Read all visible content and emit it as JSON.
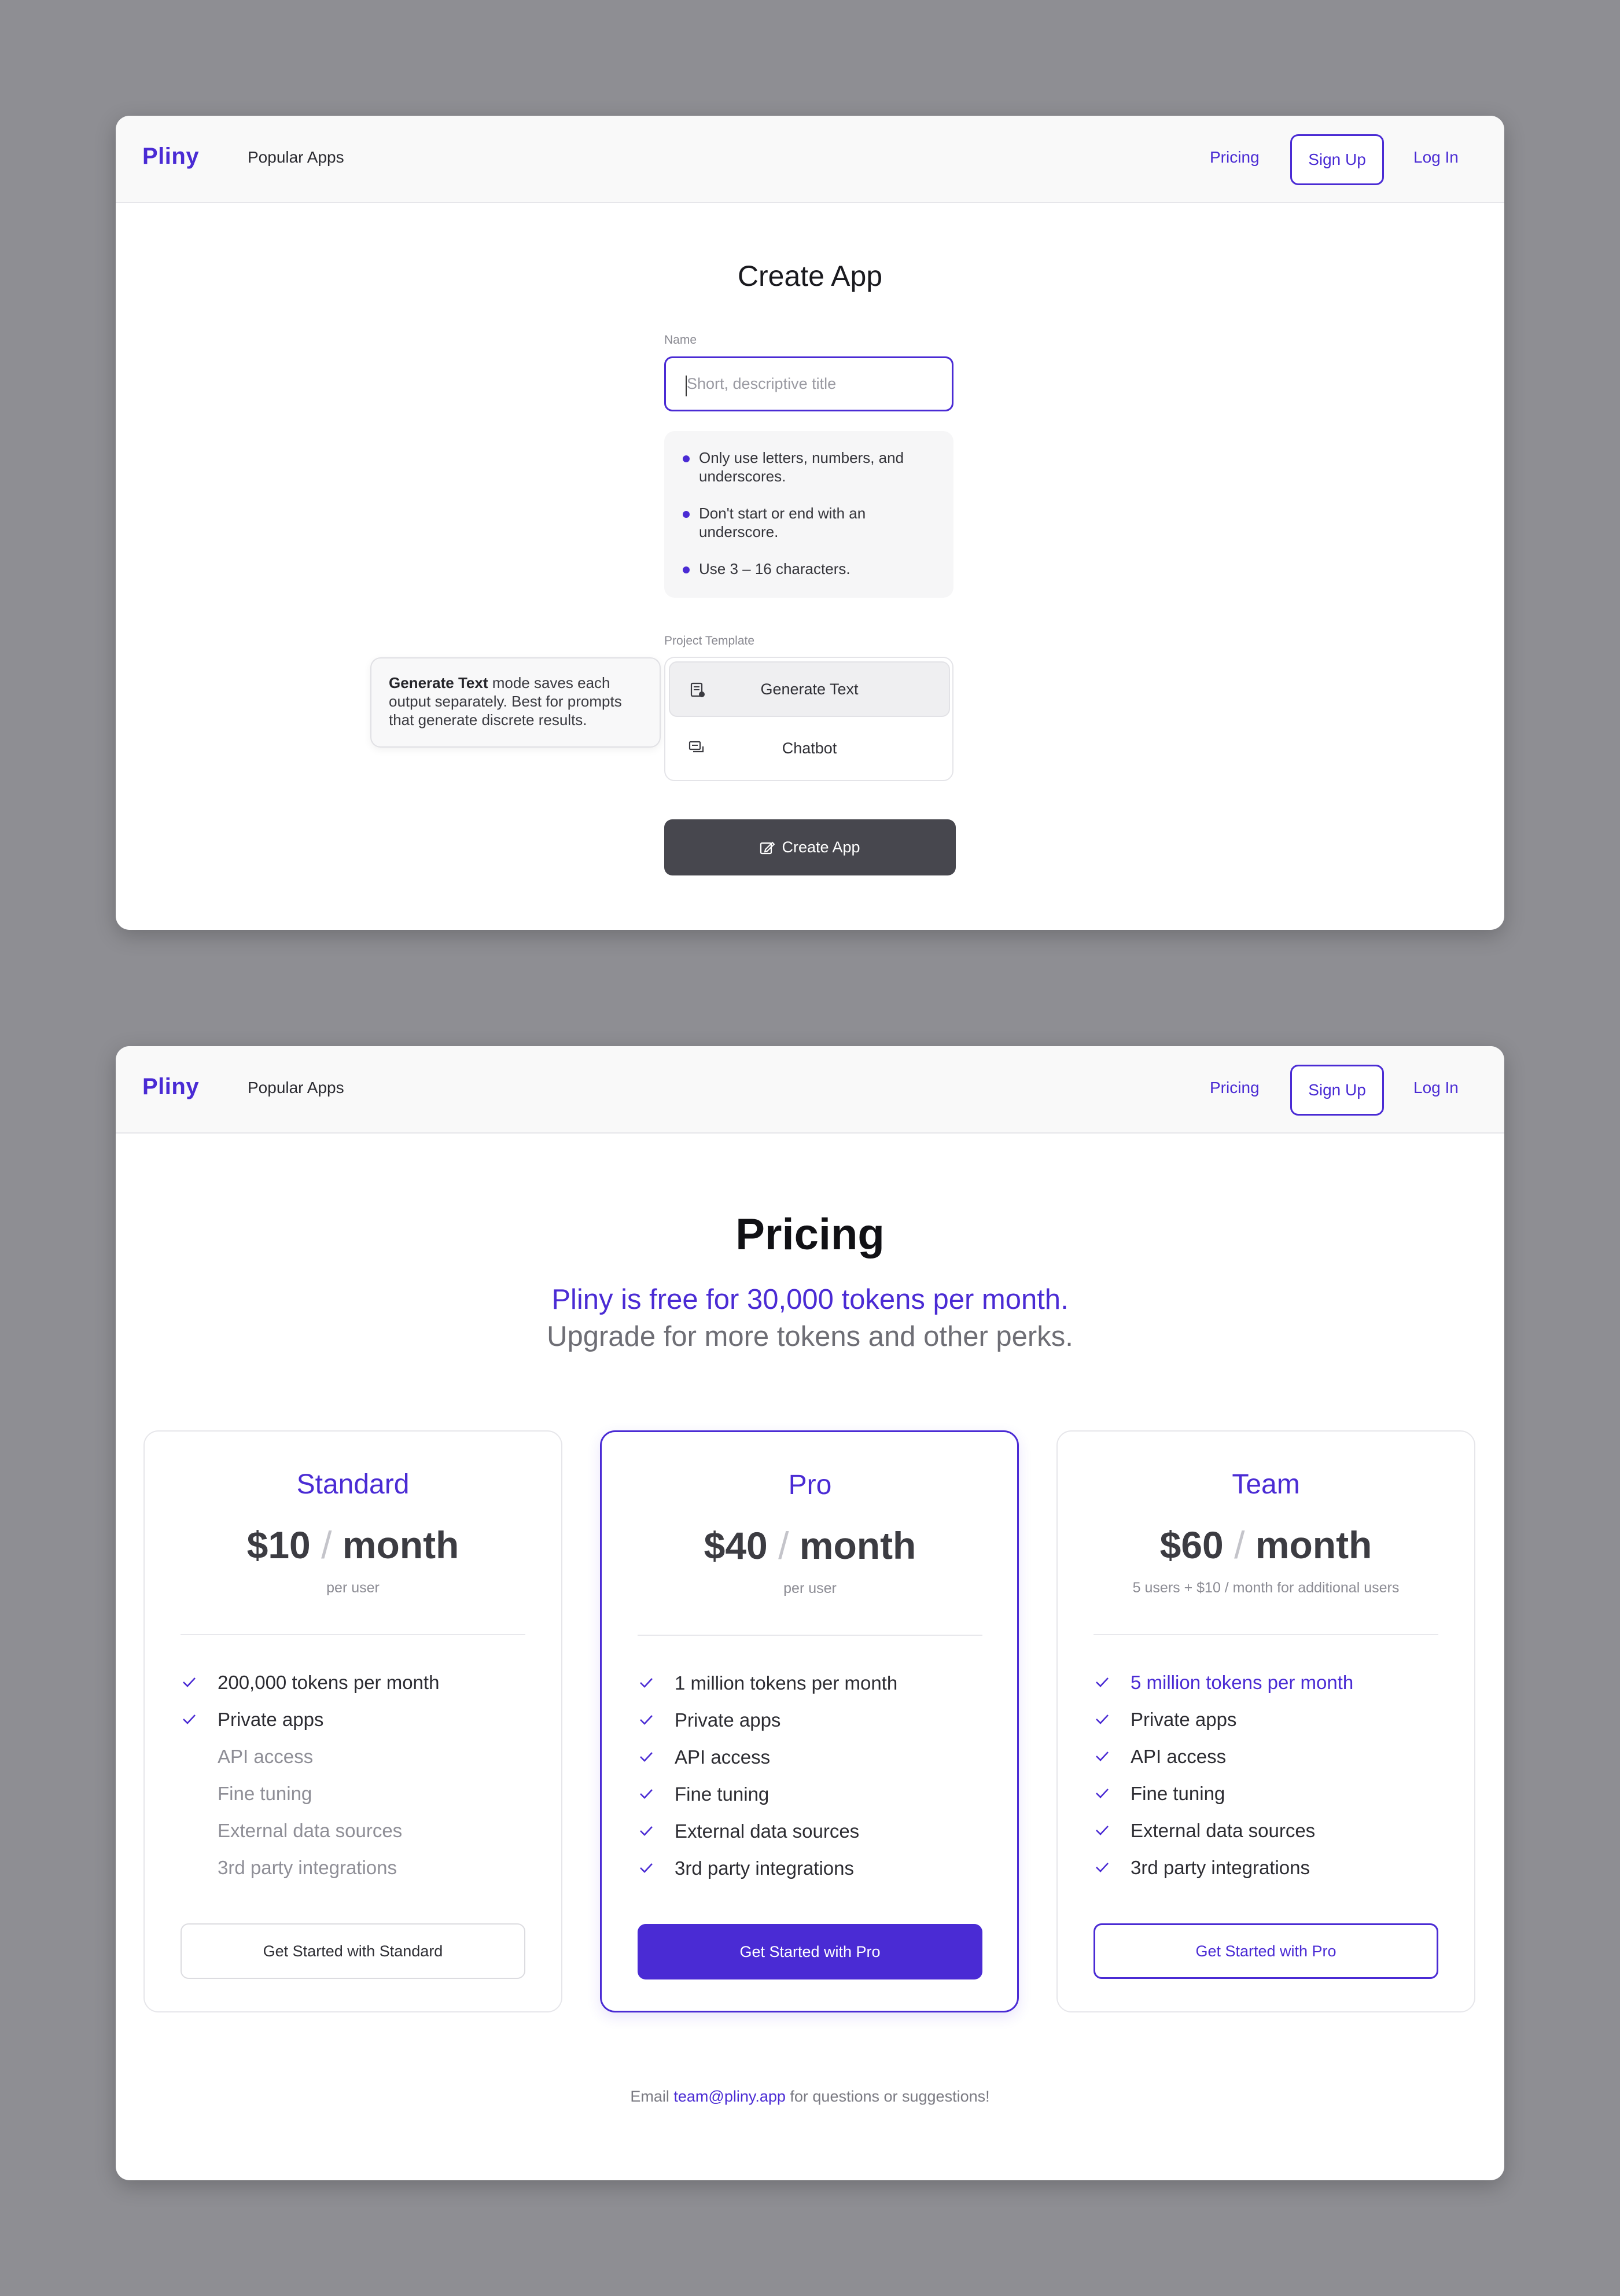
{
  "nav": {
    "logo": "Pliny",
    "popular_apps": "Popular Apps",
    "pricing": "Pricing",
    "sign_up": "Sign Up",
    "log_in": "Log In"
  },
  "create_app": {
    "title": "Create App",
    "name_label": "Name",
    "name_placeholder": "Short, descriptive title",
    "name_value": "",
    "rules": [
      "Only use letters, numbers, and underscores.",
      "Don't start or end with an underscore.",
      "Use 3 – 16 characters."
    ],
    "template_label": "Project Template",
    "templates": [
      {
        "label": "Generate Text",
        "icon": "document-icon",
        "selected": true
      },
      {
        "label": "Chatbot",
        "icon": "chat-icon",
        "selected": false
      }
    ],
    "tooltip": {
      "bold": "Generate Text",
      "text": " mode saves each output separately. Best for prompts that generate discrete results."
    },
    "submit_label": "Create App"
  },
  "pricing": {
    "title": "Pricing",
    "subtitle_line1": "Pliny is free for 30,000 tokens per month.",
    "subtitle_line2": "Upgrade for more tokens and other perks.",
    "plans": [
      {
        "name": "Standard",
        "price": "$10",
        "period": "month",
        "note": "per user",
        "features": [
          {
            "label": "200,000 tokens per month",
            "included": true
          },
          {
            "label": "Private apps",
            "included": true
          },
          {
            "label": "API access",
            "included": false
          },
          {
            "label": "Fine tuning",
            "included": false
          },
          {
            "label": "External data sources",
            "included": false
          },
          {
            "label": "3rd party integrations",
            "included": false
          }
        ],
        "cta": "Get Started with Standard"
      },
      {
        "name": "Pro",
        "price": "$40",
        "period": "month",
        "note": "per user",
        "features": [
          {
            "label": "1 million tokens per month",
            "included": true
          },
          {
            "label": "Private apps",
            "included": true
          },
          {
            "label": "API access",
            "included": true
          },
          {
            "label": "Fine tuning",
            "included": true
          },
          {
            "label": "External data sources",
            "included": true
          },
          {
            "label": "3rd party integrations",
            "included": true
          }
        ],
        "cta": "Get Started with Pro"
      },
      {
        "name": "Team",
        "price": "$60",
        "period": "month",
        "note": "5 users + $10 / month for additional users",
        "features": [
          {
            "label": "5 million tokens per month",
            "included": true,
            "highlight": true
          },
          {
            "label": "Private apps",
            "included": true
          },
          {
            "label": "API access",
            "included": true
          },
          {
            "label": "Fine tuning",
            "included": true
          },
          {
            "label": "External data sources",
            "included": true
          },
          {
            "label": "3rd party integrations",
            "included": true
          }
        ],
        "cta": "Get Started with Pro"
      }
    ],
    "footer": {
      "prefix": "Email ",
      "email": "team@pliny.app",
      "suffix": " for questions or suggestions!"
    }
  },
  "colors": {
    "accent": "#4a2bd4",
    "backdrop": "#8e8e93",
    "create_button": "#47474e"
  }
}
